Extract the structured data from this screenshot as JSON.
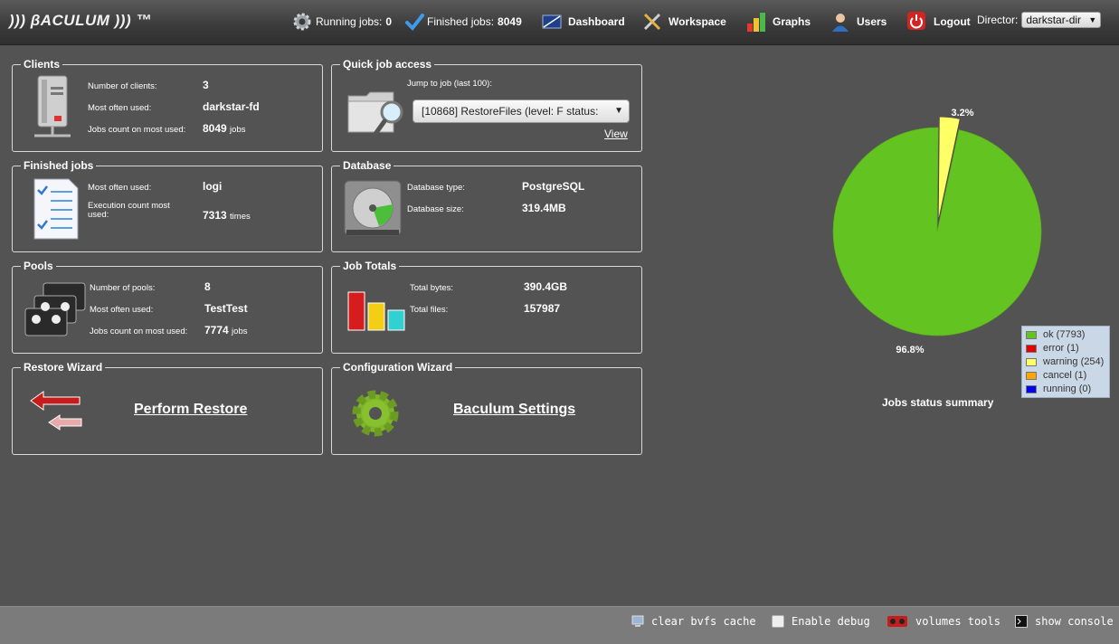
{
  "app": {
    "logo": "))) βACULUM ))) ™"
  },
  "topbar": {
    "running_label": "Running jobs:",
    "running_value": "0",
    "finished_label": "Finished jobs:",
    "finished_value": "8049",
    "dashboard": "Dashboard",
    "workspace": "Workspace",
    "graphs": "Graphs",
    "users": "Users",
    "logout": "Logout",
    "director_label": "Director:",
    "director_value": "darkstar-dir"
  },
  "clients": {
    "legend": "Clients",
    "count_label": "Number of clients:",
    "count_value": "3",
    "most_label": "Most often used:",
    "most_value": "darkstar-fd",
    "jobs_label": "Jobs count on most used:",
    "jobs_value": "8049",
    "jobs_unit": "jobs"
  },
  "quick": {
    "legend": "Quick job access",
    "jump_label": "Jump to job (last 100):",
    "jump_value": "[10868] RestoreFiles (level: F status:",
    "view": "View"
  },
  "finished": {
    "legend": "Finished jobs",
    "most_label": "Most often used:",
    "most_value": "logi",
    "exec_label": "Execution count most used:",
    "exec_value": "7313",
    "exec_unit": "times"
  },
  "database": {
    "legend": "Database",
    "type_label": "Database type:",
    "type_value": "PostgreSQL",
    "size_label": "Database size:",
    "size_value": "319.4MB"
  },
  "pools": {
    "legend": "Pools",
    "count_label": "Number of pools:",
    "count_value": "8",
    "most_label": "Most often used:",
    "most_value": "TestTest",
    "jobs_label": "Jobs count on most used:",
    "jobs_value": "7774",
    "jobs_unit": "jobs"
  },
  "totals": {
    "legend": "Job Totals",
    "bytes_label": "Total bytes:",
    "bytes_value": "390.4GB",
    "files_label": "Total files:",
    "files_value": "157987"
  },
  "restore": {
    "legend": "Restore Wizard",
    "link": "Perform Restore"
  },
  "config": {
    "legend": "Configuration Wizard",
    "link": "Baculum Settings"
  },
  "chart_data": {
    "type": "pie",
    "title": "Jobs status summary",
    "slices": [
      {
        "name": "ok (7793)",
        "value": 7793,
        "color": "#63c320",
        "label": "96.8%"
      },
      {
        "name": "error (1)",
        "value": 1,
        "color": "#e00000",
        "label": ""
      },
      {
        "name": "warning (254)",
        "value": 254,
        "color": "#ffff66",
        "label": "3.2%"
      },
      {
        "name": "cancel (1)",
        "value": 1,
        "color": "#ffa500",
        "label": ""
      },
      {
        "name": "running (0)",
        "value": 0,
        "color": "#0000ee",
        "label": ""
      }
    ],
    "legend_position": "bottom-right"
  },
  "bottom": {
    "clear": "clear bvfs cache",
    "debug": "Enable debug",
    "volumes": "volumes tools",
    "console": "show console"
  }
}
